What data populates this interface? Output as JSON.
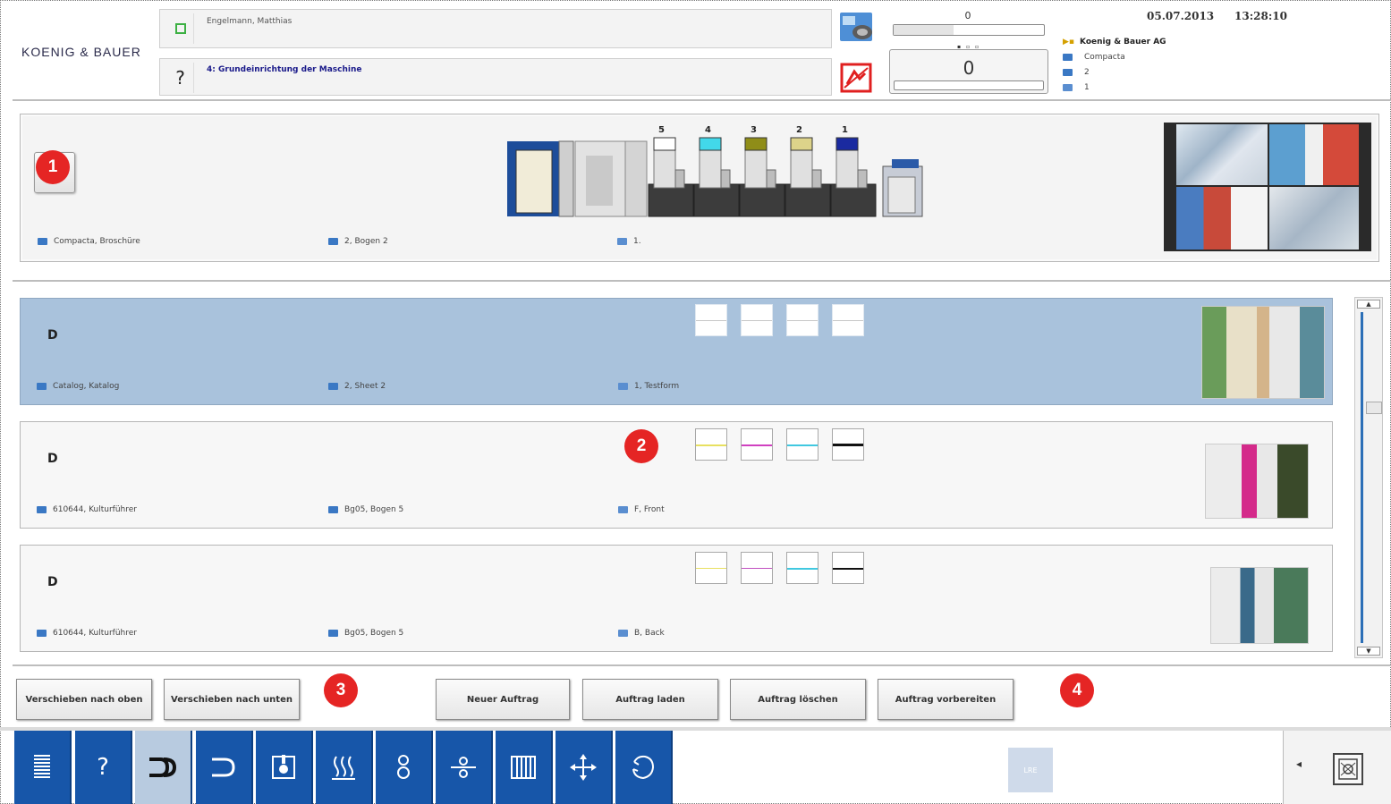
{
  "header": {
    "logo_text": "KOENIG & BAUER",
    "user_name": "Engelmann, Matthias",
    "help_icon": "?",
    "process_name": "4: Grundeinrichtung der Maschine",
    "counter_top": "0",
    "counter_main": "0",
    "date": "05.07.2013",
    "time": "13:28:10",
    "tree": [
      {
        "label": "Koenig & Bauer AG",
        "icon": "company-icon"
      },
      {
        "label": "Compacta",
        "icon": "folder-icon"
      },
      {
        "label": "2",
        "icon": "folder-icon"
      },
      {
        "label": "1",
        "icon": "pages-icon"
      }
    ]
  },
  "press": {
    "badge": "1",
    "units": [
      "5",
      "4",
      "3",
      "2",
      "1"
    ],
    "unit_colors": [
      "#ffffff",
      "#42d8ea",
      "#8f8d18",
      "#ddd38a",
      "#1a2aa0"
    ],
    "job_name": "Compacta, Broschüre",
    "sheet": "2, Bogen 2",
    "form": "1."
  },
  "jobs": [
    {
      "name": "Catalog, Katalog",
      "sheet": "2, Sheet 2",
      "form": "1, Testform",
      "selected": true
    },
    {
      "name": "610644, Kulturführer",
      "sheet": "Bg05, Bogen 5",
      "form": "F, Front",
      "selected": false
    },
    {
      "name": "610644, Kulturführer",
      "sheet": "Bg05, Bogen 5",
      "form": "B, Back",
      "selected": false
    }
  ],
  "badges": {
    "b2": "2",
    "b3": "3",
    "b4": "4"
  },
  "actions": {
    "move_up": "Verschieben nach oben",
    "move_down": "Verschieben nach unten",
    "new_job": "Neuer Auftrag",
    "load_job": "Auftrag laden",
    "delete_job": "Auftrag löschen",
    "prepare_job": "Auftrag vorbereiten"
  },
  "toolbar": {
    "help": "?",
    "center_label": "LRE",
    "arrow": "◂"
  },
  "colors": {
    "toolbar_blue": "#1756a9",
    "selected_row": "#a9c2dc",
    "badge_red": "#e52524"
  }
}
